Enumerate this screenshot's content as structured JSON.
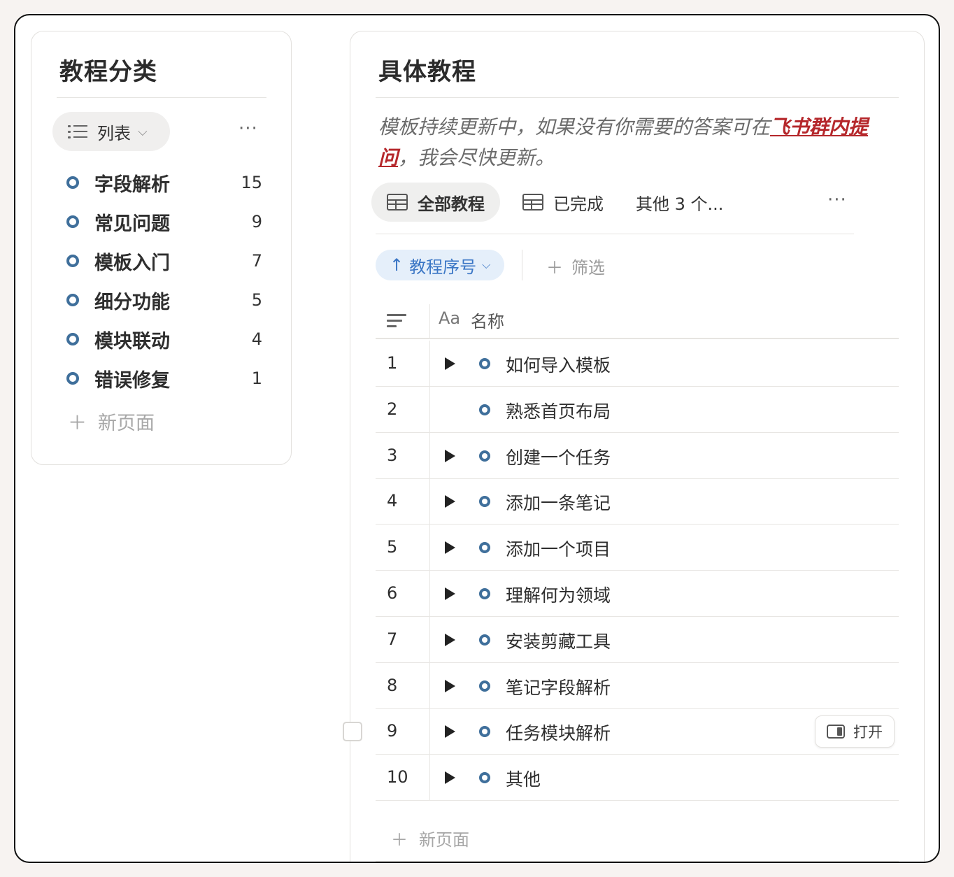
{
  "left_panel": {
    "title": "教程分类",
    "view": {
      "label": "列表",
      "icon": "list-icon"
    },
    "more_icon": "more-horizontal-icon",
    "categories": [
      {
        "label": "字段解析",
        "count": "15"
      },
      {
        "label": "常见问题",
        "count": "9"
      },
      {
        "label": "模板入门",
        "count": "7"
      },
      {
        "label": "细分功能",
        "count": "5"
      },
      {
        "label": "模块联动",
        "count": "4"
      },
      {
        "label": "错误修复",
        "count": "1"
      }
    ],
    "new_page": "新页面"
  },
  "right_panel": {
    "title": "具体教程",
    "description_prefix": "模板持续更新中，如果没有你需要的答案可在",
    "description_link": "飞书群内提问",
    "description_suffix": "，我会尽快更新。",
    "tabs": [
      {
        "label": "全部教程",
        "active": true,
        "icon": "table-icon"
      },
      {
        "label": "已完成",
        "active": false,
        "icon": "table-icon"
      },
      {
        "label": "其他 3 个...",
        "active": false
      }
    ],
    "sort": {
      "label": "教程序号",
      "direction": "ascending"
    },
    "filter_label": "筛选",
    "columns": {
      "sort_col_icon": "lines-icon",
      "name_type": "Aa",
      "name_label": "名称"
    },
    "rows": [
      {
        "num": "1",
        "title": "如何导入模板",
        "has_toggle": true
      },
      {
        "num": "2",
        "title": "熟悉首页布局",
        "has_toggle": false
      },
      {
        "num": "3",
        "title": "创建一个任务",
        "has_toggle": true
      },
      {
        "num": "4",
        "title": "添加一条笔记",
        "has_toggle": true
      },
      {
        "num": "5",
        "title": "添加一个项目",
        "has_toggle": true
      },
      {
        "num": "6",
        "title": "理解何为领域",
        "has_toggle": true
      },
      {
        "num": "7",
        "title": "安装剪藏工具",
        "has_toggle": true
      },
      {
        "num": "8",
        "title": "笔记字段解析",
        "has_toggle": true
      },
      {
        "num": "9",
        "title": "任务模块解析",
        "has_toggle": true,
        "open_label": "打开"
      },
      {
        "num": "10",
        "title": "其他",
        "has_toggle": true
      }
    ],
    "new_page": "新页面"
  },
  "colors": {
    "accent_ring": "#3f6f9b",
    "link_red": "#b5272b",
    "sort_blue": "#3a76c5",
    "sort_bg": "#e5effa"
  }
}
